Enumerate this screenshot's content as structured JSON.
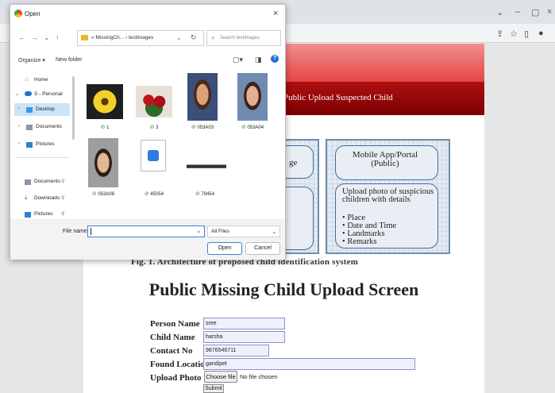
{
  "browser": {
    "minimize": "–",
    "maximize": "▢",
    "close": "×",
    "chevron": "⌄"
  },
  "page": {
    "nav_link": "Public Upload Suspected Child",
    "diagram": {
      "left_box_partial": "ge",
      "right_box_title": "Mobile App/Portal (Public)",
      "right_box_text": "Upload photo of suspicious children with details",
      "bullets": [
        "Place",
        "Date and Time",
        "Landmarks",
        "Remarks"
      ]
    },
    "fig_caption": "Fig. 1.   Architecture of proposed child identification system",
    "title": "Public Missing Child Upload Screen",
    "form": {
      "person_name_label": "Person Name",
      "person_name_value": "sree",
      "child_name_label": "Child Name",
      "child_name_value": "harsha",
      "contact_label": "Contact No",
      "contact_value": "9876546711",
      "location_label": "Found Location",
      "location_value": "gandipet",
      "photo_label": "Upload Photo",
      "choose_file": "Choose file",
      "no_file": "No file chosen",
      "submit": "Submit"
    }
  },
  "dialog": {
    "title": "Open",
    "close": "×",
    "path": "« MissingCh... › testimages",
    "search_placeholder": "Search testimages",
    "organize": "Organize ▾",
    "new_folder": "New folder",
    "sidebar": [
      {
        "label": "Home",
        "icon": "home-icon"
      },
      {
        "label": "S - Personal",
        "icon": "cloud-icon"
      },
      {
        "label": "Desktop",
        "icon": "desktop-folder-icon"
      },
      {
        "label": "Documents",
        "icon": "documents-icon"
      },
      {
        "label": "Pictures",
        "icon": "pictures-icon"
      },
      {
        "label": "Documents",
        "icon": "documents-icon"
      },
      {
        "label": "Downloads",
        "icon": "download-icon"
      },
      {
        "label": "Pictures",
        "icon": "pictures-icon"
      }
    ],
    "files": [
      "1",
      "3",
      "053A03",
      "053A04",
      "053A06",
      "45054",
      "79454"
    ],
    "file_name_label": "File name:",
    "file_type": "All Files",
    "open": "Open",
    "cancel": "Cancel"
  },
  "colors": {
    "banner_red": "#e64545",
    "nav_dark_red": "#8b0000",
    "dialog_accent": "#3c7fd8"
  }
}
